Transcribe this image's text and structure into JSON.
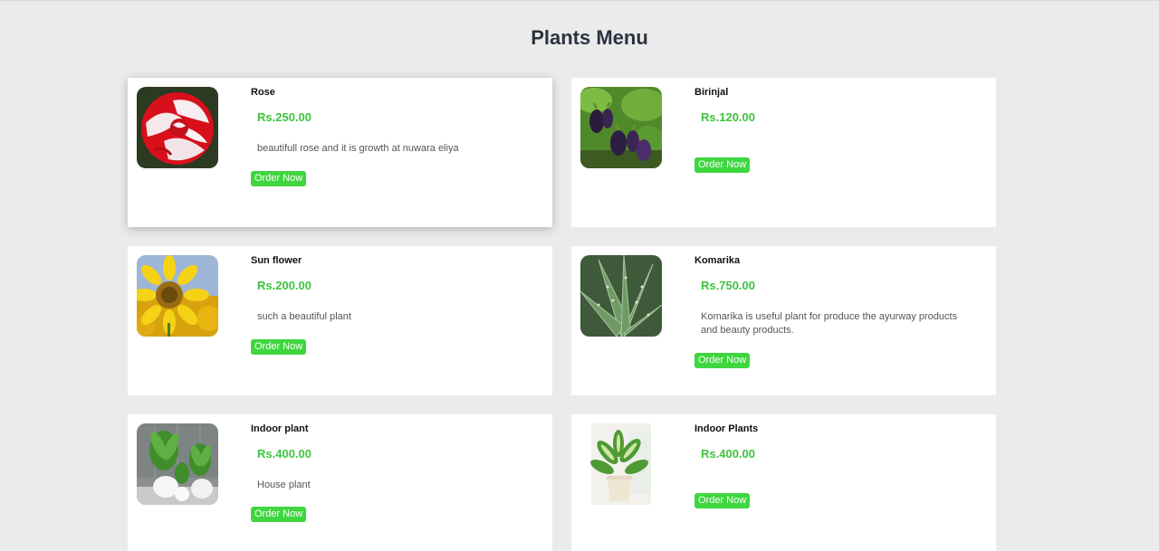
{
  "page": {
    "title": "Plants Menu"
  },
  "colors": {
    "background": "#ebebeb",
    "price": "#3ec43e",
    "button": "#3fd63f",
    "title": "#2b3340"
  },
  "products": [
    {
      "name": "Rose",
      "price": "Rs.250.00",
      "description": "beautifull rose and it is growth at nuwara eliya",
      "button": "Order Now",
      "image": "red-white-rose-image"
    },
    {
      "name": "Birinjal",
      "price": "Rs.120.00",
      "description": "",
      "button": "Order Now",
      "image": "eggplant-image"
    },
    {
      "name": "Sun flower",
      "price": "Rs.200.00",
      "description": "such a beautiful plant",
      "button": "Order Now",
      "image": "sunflower-image"
    },
    {
      "name": "Komarika",
      "price": "Rs.750.00",
      "description": "Komarika is useful plant for produce the ayurway products and beauty products.",
      "button": "Order Now",
      "image": "aloe-vera-image"
    },
    {
      "name": "Indoor plant",
      "price": "Rs.400.00",
      "description": "House plant",
      "button": "Order Now",
      "image": "potted-palms-image"
    },
    {
      "name": "Indoor Plants",
      "price": "Rs.400.00",
      "description": "",
      "button": "Order Now",
      "image": "dieffenbachia-pot-image"
    }
  ]
}
